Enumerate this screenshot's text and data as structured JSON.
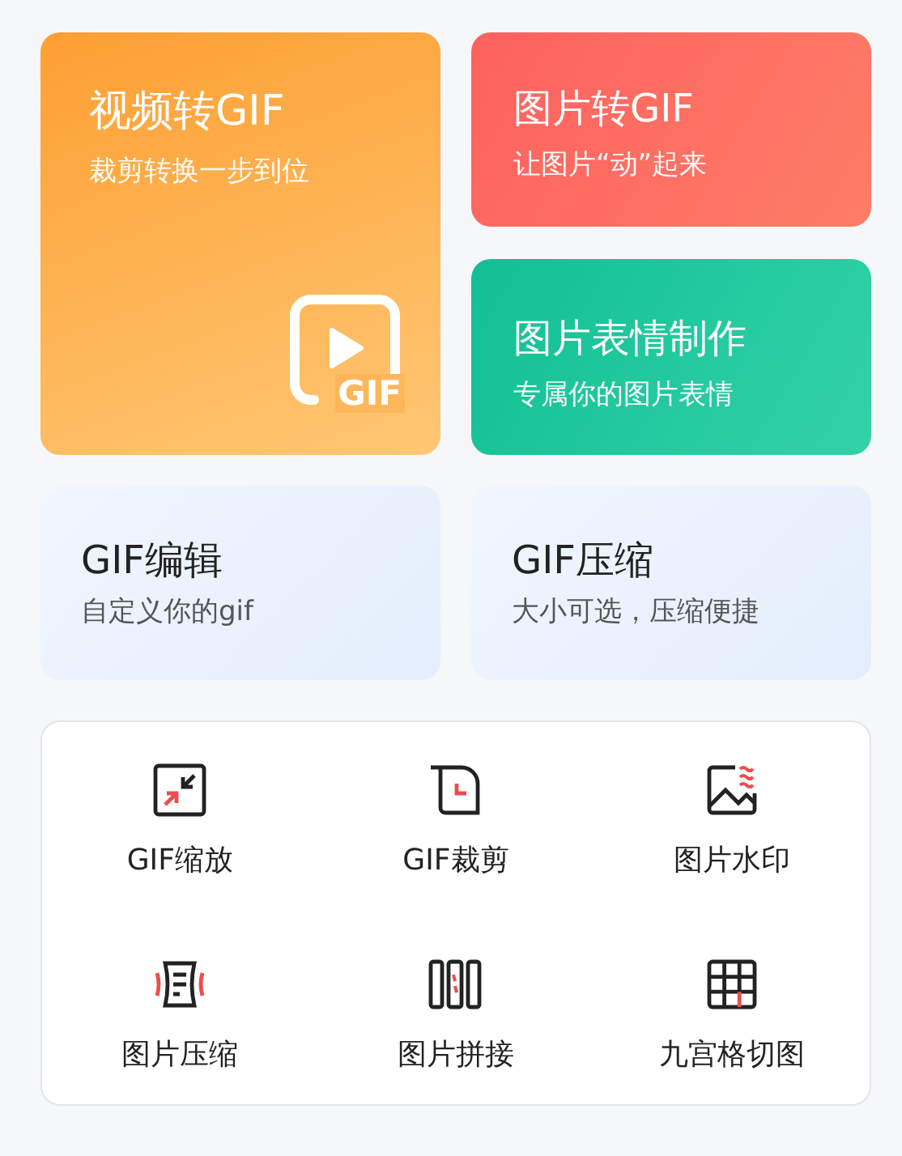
{
  "feature_cards": [
    {
      "kind": "orange",
      "title": "视频转GIF",
      "subtitle": "裁剪转换一步到位"
    },
    {
      "kind": "red",
      "title": "图片转GIF",
      "subtitle": "让图片“动”起来"
    },
    {
      "kind": "green",
      "title": "图片表情制作",
      "subtitle": "专属你的图片表情"
    }
  ],
  "secondary_cards": [
    {
      "title": "GIF编辑",
      "subtitle": "自定义你的gif"
    },
    {
      "title": "GIF压缩",
      "subtitle": "大小可选，压缩便捷"
    }
  ],
  "badge_text": "GIF",
  "tools": [
    {
      "label": "GIF缩放"
    },
    {
      "label": "GIF裁剪"
    },
    {
      "label": "图片水印"
    },
    {
      "label": "图片压缩"
    },
    {
      "label": "图片拼接"
    },
    {
      "label": "九宫格切图"
    }
  ]
}
